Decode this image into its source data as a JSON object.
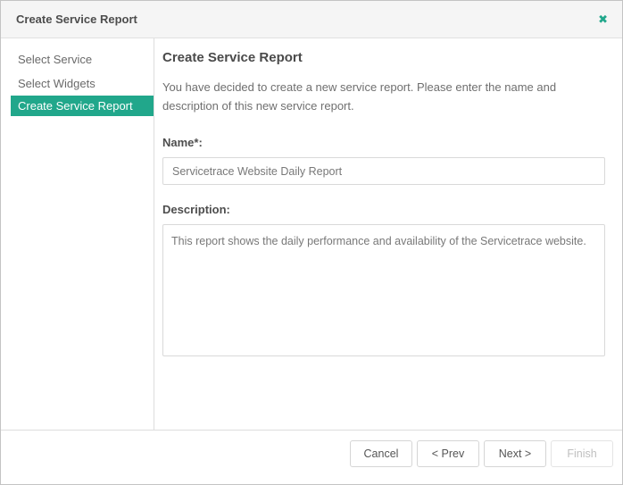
{
  "colors": {
    "accent": "#21a78b"
  },
  "dialog": {
    "title": "Create Service Report",
    "close_icon": "✖"
  },
  "sidebar": {
    "items": [
      {
        "label": "Select Service",
        "active": false
      },
      {
        "label": "Select Widgets",
        "active": false
      },
      {
        "label": "Create Service Report",
        "active": true
      }
    ]
  },
  "main": {
    "heading": "Create Service Report",
    "intro_line1": "You have decided to create a new service report. Please enter the name and",
    "intro_line2": "description of this new service report.",
    "name": {
      "label": "Name*:",
      "value": "Servicetrace Website Daily Report"
    },
    "description": {
      "label": "Description:",
      "value": "This report shows the daily performance and availability of the Servicetrace website."
    }
  },
  "footer": {
    "buttons": [
      {
        "label": "Cancel",
        "enabled": true
      },
      {
        "label": "< Prev",
        "enabled": true
      },
      {
        "label": "Next >",
        "enabled": true
      },
      {
        "label": "Finish",
        "enabled": false
      }
    ]
  }
}
